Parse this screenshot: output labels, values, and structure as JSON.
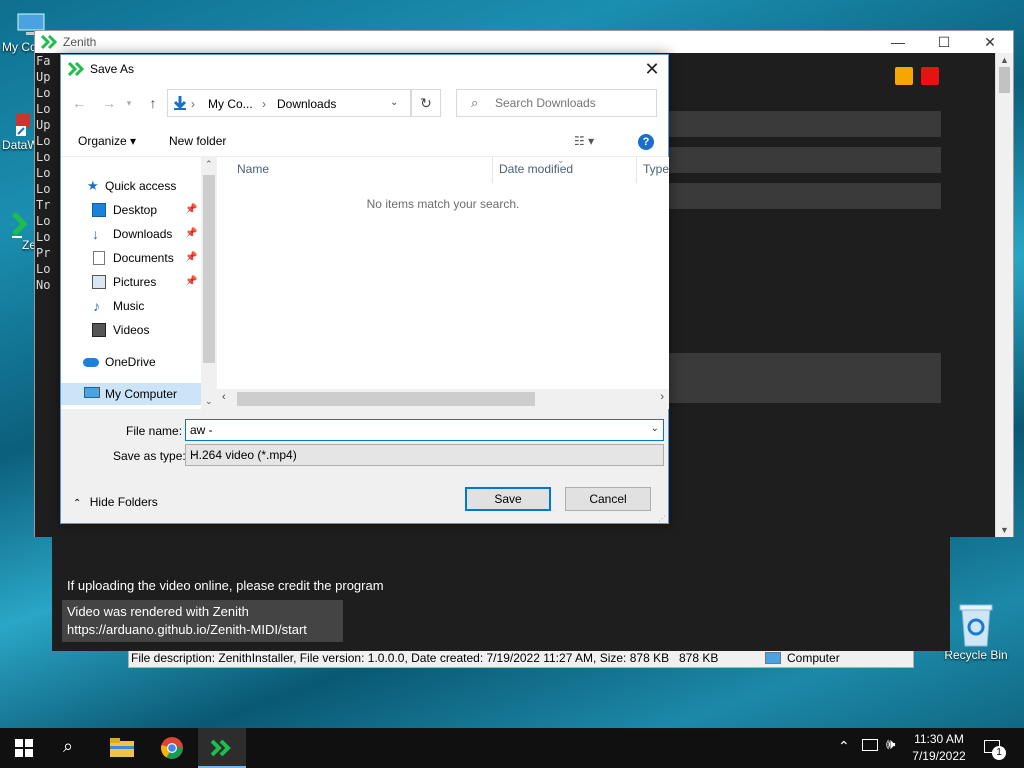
{
  "desktop": {
    "icons": [
      {
        "label": "My Co"
      },
      {
        "label": "DataW"
      },
      {
        "label": "Ze"
      },
      {
        "label": "Recycle Bin"
      }
    ]
  },
  "background_explorer": {
    "description": "File description: ZenithInstaller, File version: 1.0.0.0, Date created: 7/19/2022 11:27 AM, Size: 878 KB",
    "size": "878 KB",
    "location": "Computer"
  },
  "zenith": {
    "title": "Zenith",
    "log_lines": [
      "Fa",
      "Up",
      "Lo",
      "Lo",
      "Up",
      "Lo",
      "Lo",
      "Lo",
      "Lo",
      "Tr",
      "Lo",
      "Lo",
      "Pr",
      "Lo",
      "No"
    ],
    "credit_line": "If uploading the video online, please credit the program",
    "credit_box_line1": "Video was rendered with Zenith",
    "credit_box_line2": "https://arduano.github.io/Zenith-MIDI/start",
    "colors": {
      "orange": "#f5a600",
      "red": "#e81212",
      "accent": "#1dbf4a"
    }
  },
  "save_dialog": {
    "title": "Save As",
    "breadcrumb": [
      "My Co...",
      "Downloads"
    ],
    "search_placeholder": "Search Downloads",
    "toolbar": {
      "organize": "Organize",
      "new_folder": "New folder",
      "help": "?"
    },
    "nav": {
      "quick_access": "Quick access",
      "items": [
        "Desktop",
        "Downloads",
        "Documents",
        "Pictures",
        "Music",
        "Videos"
      ],
      "onedrive": "OneDrive",
      "my_computer": "My Computer"
    },
    "columns": [
      "Name",
      "Date modified",
      "Type"
    ],
    "empty_message": "No items match your search.",
    "file_name_label": "File name:",
    "file_name_value": "aw - ",
    "save_as_type_label": "Save as type:",
    "save_as_type_value": "H.264 video (*.mp4)",
    "save_label": "Save",
    "cancel_label": "Cancel",
    "hide_folders_label": "Hide Folders"
  },
  "taskbar": {
    "time": "11:30 AM",
    "date": "7/19/2022",
    "notification_count": "1"
  }
}
